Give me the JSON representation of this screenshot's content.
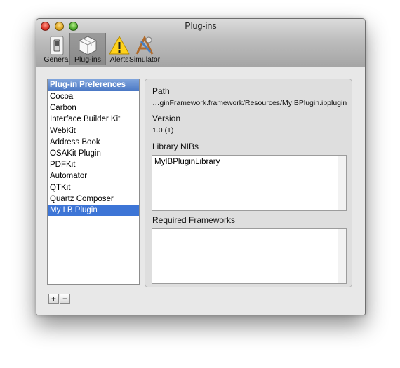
{
  "window": {
    "title": "Plug-ins"
  },
  "toolbar": {
    "items": [
      {
        "label": "General",
        "icon": "light-switch-icon"
      },
      {
        "label": "Plug-ins",
        "icon": "plugin-cube-icon"
      },
      {
        "label": "Alerts",
        "icon": "warning-icon"
      },
      {
        "label": "Simulator",
        "icon": "simulator-icon"
      }
    ],
    "selected": "Plug-ins"
  },
  "plugins": {
    "header": "Plug-in Preferences",
    "items": [
      "Cocoa",
      "Carbon",
      "Interface Builder Kit",
      "WebKit",
      "Address Book",
      "OSAKit Plugin",
      "PDFKit",
      "Automator",
      "QTKit",
      "Quartz Composer",
      "My I B Plugin"
    ],
    "selected": "My I B Plugin",
    "add_label": "+",
    "remove_label": "−"
  },
  "details": {
    "path_label": "Path",
    "path_value": "…ginFramework.framework/Resources/MyIBPlugin.ibplugin",
    "version_label": "Version",
    "version_value": "1.0 (1)",
    "nibs_label": "Library NIBs",
    "nibs": [
      "MyIBPluginLibrary"
    ],
    "frameworks_label": "Required Frameworks",
    "frameworks": []
  },
  "colors": {
    "selection": "#3d75d6",
    "header": "#4a78c5"
  }
}
